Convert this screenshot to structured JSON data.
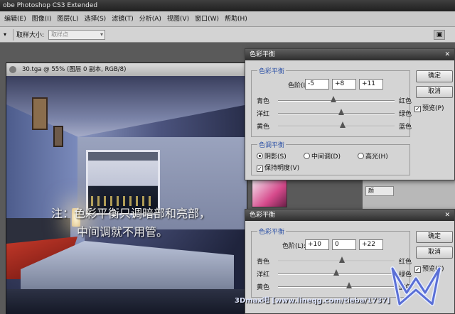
{
  "app": {
    "title": "obe Photoshop CS3 Extended"
  },
  "menu": [
    "编辑(E)",
    "图像(I)",
    "图层(L)",
    "选择(S)",
    "滤镜(T)",
    "分析(A)",
    "视图(V)",
    "窗口(W)",
    "帮助(H)"
  ],
  "options": {
    "sample_size_label": "取样大小:",
    "sample_size_value": "取样点"
  },
  "document": {
    "title": "30.tga @ 55% (图层 0 副本, RGB/8)"
  },
  "note": {
    "line1": "注：色彩平衡只调暗部和亮部，",
    "line2": "中间调就不用管。"
  },
  "panel": {
    "tab_label": "颜"
  },
  "dialog1": {
    "title": "色彩平衡",
    "group_color_balance": "色彩平衡",
    "levels_label": "色阶(L):",
    "levels": [
      "-5",
      "+8",
      "+11"
    ],
    "sliders": [
      {
        "left": "青色",
        "right": "红色",
        "value": -5
      },
      {
        "left": "洋红",
        "right": "绿色",
        "value": 8
      },
      {
        "left": "黄色",
        "right": "蓝色",
        "value": 11
      }
    ],
    "group_tone": "色调平衡",
    "tone_options": [
      "阴影(S)",
      "中间调(D)",
      "高光(H)"
    ],
    "tone_selected": "阴影(S)",
    "preserve_label": "保持明度(V)",
    "preserve_checked": true,
    "ok_label": "确定",
    "cancel_label": "取消",
    "preview_label": "预览(P)",
    "preview_checked": true
  },
  "dialog2": {
    "title": "色彩平衡",
    "group_color_balance": "色彩平衡",
    "levels_label": "色阶(L):",
    "levels": [
      "+10",
      "0",
      "+22"
    ],
    "sliders": [
      {
        "left": "青色",
        "right": "红色",
        "value": 10
      },
      {
        "left": "洋红",
        "right": "绿色",
        "value": 0
      },
      {
        "left": "黄色",
        "right": "蓝色",
        "value": 22
      }
    ],
    "ok_label": "确定",
    "cancel_label": "取消",
    "preview_label": "预览(P)",
    "preview_checked": true
  },
  "watermark": "3Dmax吧 [www.lineqg.com/tieba/1737]"
}
